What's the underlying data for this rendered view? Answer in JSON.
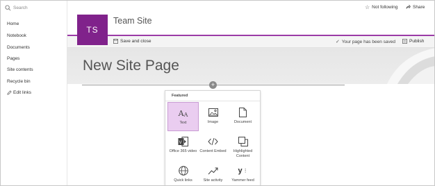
{
  "nav": {
    "search_placeholder": "Search",
    "items": [
      "Home",
      "Notebook",
      "Documents",
      "Pages",
      "Site contents",
      "Recycle bin"
    ],
    "edit_links": "Edit links"
  },
  "header": {
    "site_initials": "TS",
    "site_title": "Team Site",
    "follow_label": "Not following",
    "share_label": "Share"
  },
  "command_bar": {
    "save_close_label": "Save and close",
    "saved_message": "Your page has been saved",
    "publish_label": "Publish"
  },
  "page": {
    "title": "New Site Page"
  },
  "toolbox": {
    "section_label": "Featured",
    "tools": [
      {
        "label": "Text",
        "icon": "text-icon",
        "selected": true
      },
      {
        "label": "Image",
        "icon": "image-icon",
        "selected": false
      },
      {
        "label": "Document",
        "icon": "document-icon",
        "selected": false
      },
      {
        "label": "Office 365 video",
        "icon": "video-icon",
        "selected": false
      },
      {
        "label": "Content Embed",
        "icon": "embed-icon",
        "selected": false
      },
      {
        "label": "Highlighted Content",
        "icon": "highlighted-content-icon",
        "selected": false
      },
      {
        "label": "Quick links",
        "icon": "globe-icon",
        "selected": false
      },
      {
        "label": "Site activity",
        "icon": "activity-icon",
        "selected": false
      },
      {
        "label": "Yammer feed",
        "icon": "yammer-icon",
        "selected": false
      }
    ]
  },
  "colors": {
    "accent": "#80228b",
    "selected_tool": "#eacdf0"
  }
}
